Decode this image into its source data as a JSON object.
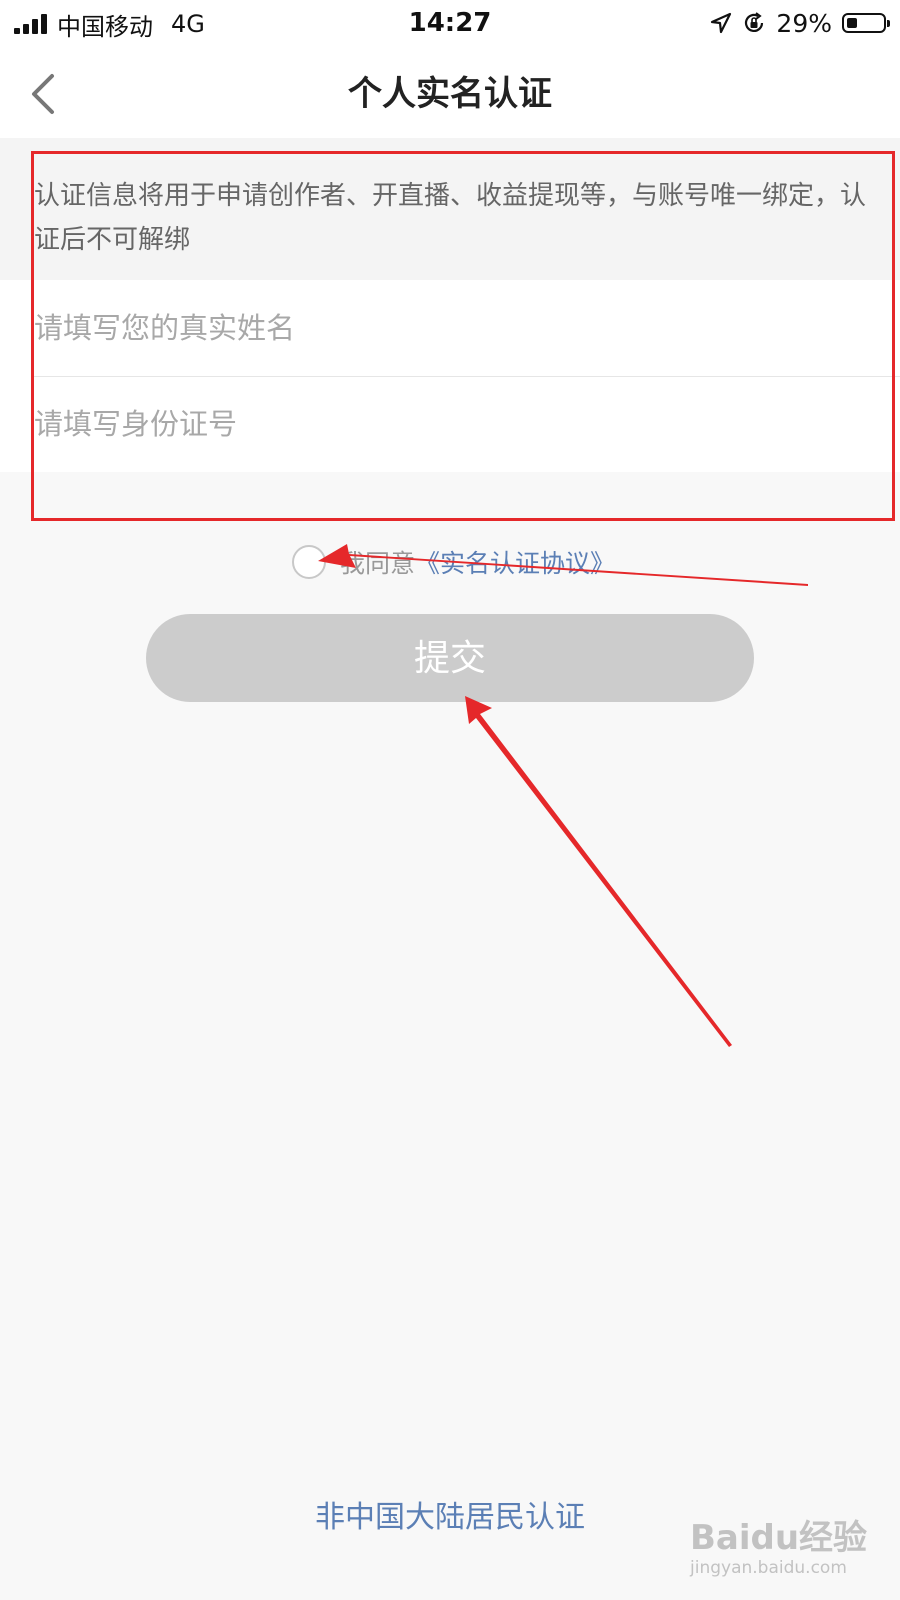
{
  "status_bar": {
    "carrier": "中国移动",
    "network": "4G",
    "time": "14:27",
    "battery_percent_text": "29%",
    "battery_level": 0.29,
    "icons": [
      "signal-icon",
      "location-icon",
      "orientation-lock-icon",
      "battery-icon"
    ]
  },
  "header": {
    "title": "个人实名认证",
    "back_icon": "chevron-left-icon"
  },
  "notice": {
    "text": "认证信息将用于申请创作者、开直播、收益提现等，与账号唯一绑定，认证后不可解绑"
  },
  "form": {
    "name_placeholder": "请填写您的真实姓名",
    "name_value": "",
    "id_placeholder": "请填写身份证号",
    "id_value": ""
  },
  "agreement": {
    "prefix": "我同意",
    "link_text": "《实名认证协议》",
    "checked": false
  },
  "submit": {
    "label": "提交"
  },
  "footer": {
    "foreign_link": "非中国大陆居民认证"
  },
  "annotation": {
    "box_color": "#e5282a",
    "arrow_color": "#e5282a"
  },
  "watermark": {
    "logo": "Baidu经验",
    "url": "jingyan.baidu.com"
  },
  "colors": {
    "link": "#5b7fb5",
    "button_disabled": "#cccccc",
    "background": "#f8f8f8"
  }
}
